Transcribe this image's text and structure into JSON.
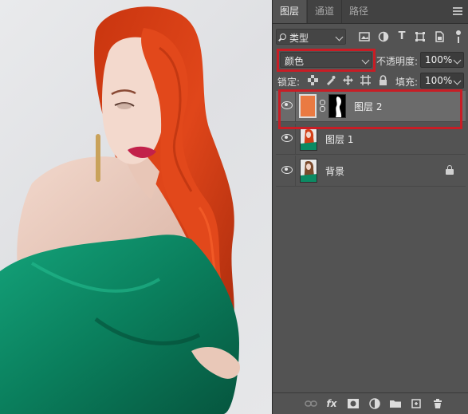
{
  "tabs": [
    {
      "label": "图层",
      "active": true
    },
    {
      "label": "通道",
      "active": false
    },
    {
      "label": "路径",
      "active": false
    }
  ],
  "filter": {
    "kind_label": "类型",
    "icons": [
      "image-filter-icon",
      "adjustment-filter-icon",
      "type-filter-icon",
      "shape-filter-icon",
      "smart-object-filter-icon"
    ]
  },
  "blend": {
    "mode": "颜色",
    "opacity_label": "不透明度:",
    "opacity_value": "100%"
  },
  "lock": {
    "label": "锁定:",
    "fill_label": "填充:",
    "fill_value": "100%"
  },
  "layers": [
    {
      "name": "图层 2",
      "selected": true,
      "thumb_color": "#ea7a42",
      "has_mask": true,
      "locked": false
    },
    {
      "name": "图层 1",
      "selected": false,
      "locked": false
    },
    {
      "name": "背景",
      "selected": false,
      "locked": true
    }
  ],
  "bottom_bar": {
    "fx_label": "fx"
  },
  "colors": {
    "highlight": "#c81d25",
    "panel_bg": "#535353",
    "layer_fill": "#ea7a42"
  }
}
